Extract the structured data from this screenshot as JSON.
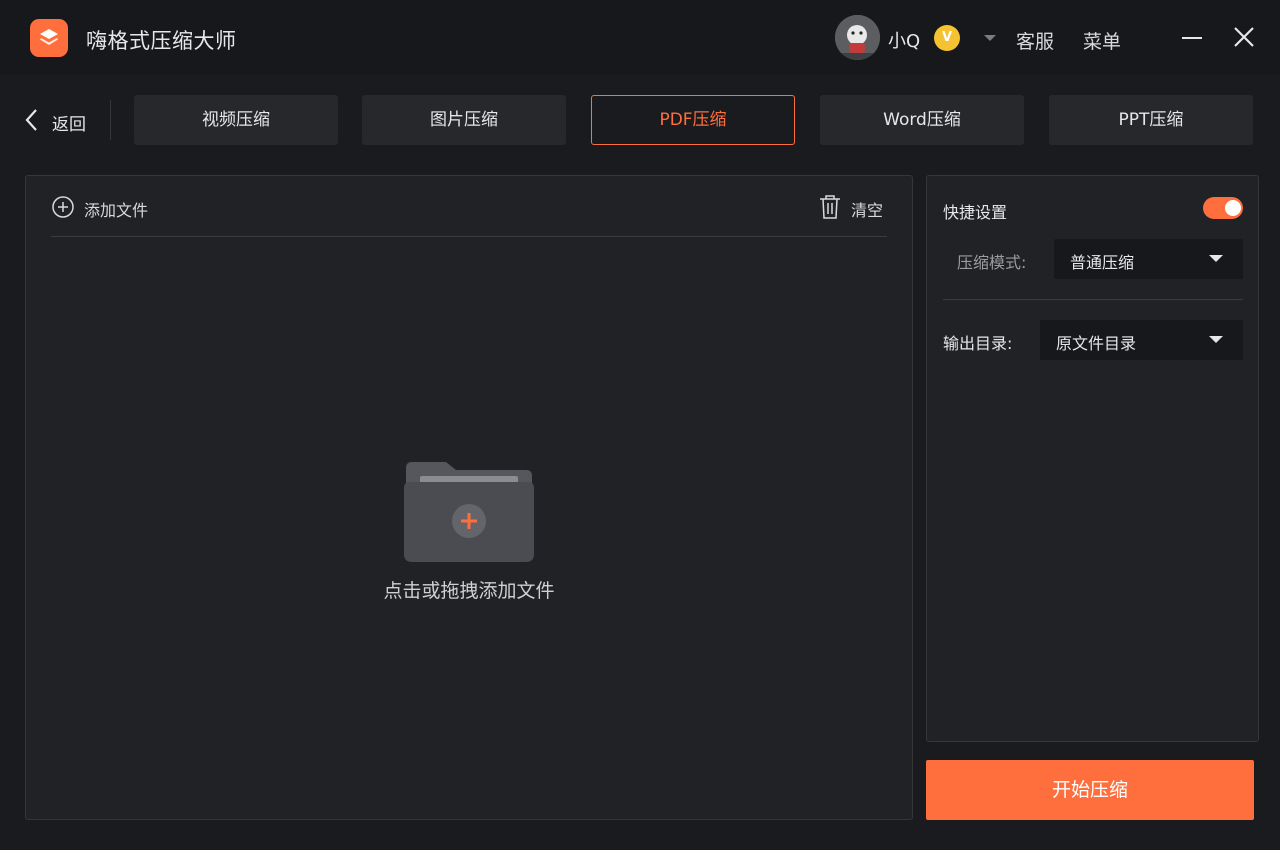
{
  "app": {
    "title": "嗨格式压缩大师",
    "accent_color": "#ff6f3d"
  },
  "user": {
    "name": "小Q",
    "vip_badge": "V"
  },
  "header": {
    "service_label": "客服",
    "menu_label": "菜单"
  },
  "nav": {
    "back_label": "返回",
    "tabs": [
      {
        "label": "视频压缩",
        "active": false
      },
      {
        "label": "图片压缩",
        "active": false
      },
      {
        "label": "PDF压缩",
        "active": true
      },
      {
        "label": "Word压缩",
        "active": false
      },
      {
        "label": "PPT压缩",
        "active": false
      }
    ]
  },
  "file_panel": {
    "add_file_label": "添加文件",
    "clear_label": "清空",
    "drop_hint": "点击或拖拽添加文件"
  },
  "settings": {
    "quick_settings_label": "快捷设置",
    "quick_settings_enabled": true,
    "compress_mode_label": "压缩模式:",
    "compress_mode_value": "普通压缩",
    "output_dir_label": "输出目录:",
    "output_dir_value": "原文件目录"
  },
  "actions": {
    "start_label": "开始压缩"
  }
}
